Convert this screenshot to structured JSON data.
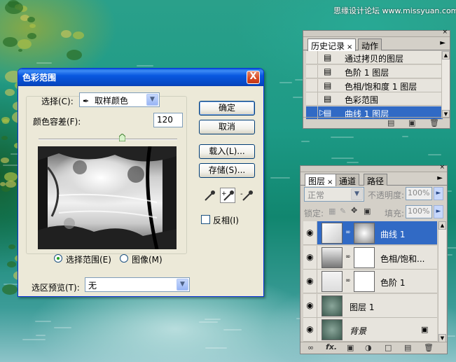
{
  "watermark": "思缘设计论坛 www.missyuan.com",
  "dialog": {
    "title": "色彩范围",
    "close_label": "X",
    "select_label": "选择(C):",
    "select_value": "取样颜色",
    "fuzziness_label": "颜色容差(F):",
    "fuzziness_value": "120",
    "fuzziness_level": 120,
    "fuzziness_max": 200,
    "radio_selection": "选择范围(E)",
    "radio_image": "图像(M)",
    "selected_radio": "selection",
    "preview_label": "选区预览(T):",
    "preview_value": "无",
    "buttons": {
      "ok": "确定",
      "cancel": "取消",
      "load": "载入(L)...",
      "save": "存储(S)..."
    },
    "invert_label": "反相(I)",
    "invert_checked": false
  },
  "history_panel": {
    "tabs": [
      {
        "label": "历史记录",
        "active": true
      },
      {
        "label": "动作",
        "active": false
      }
    ],
    "items": [
      {
        "label": "通过拷贝的图层",
        "selected": false
      },
      {
        "label": "色阶 1 图层",
        "selected": false
      },
      {
        "label": "色相/饱和度 1 图层",
        "selected": false
      },
      {
        "label": "色彩范围",
        "selected": false
      },
      {
        "label": "曲线 1 图层",
        "selected": true
      }
    ]
  },
  "layers_panel": {
    "tabs": [
      {
        "label": "图层",
        "active": true
      },
      {
        "label": "通道",
        "active": false
      },
      {
        "label": "路径",
        "active": false
      }
    ],
    "blend_mode": "正常",
    "opacity_label": "不透明度:",
    "opacity_value": "100%",
    "lock_label": "锁定:",
    "fill_label": "填充:",
    "fill_value": "100%",
    "layers": [
      {
        "name": "曲线 1",
        "selected": true
      },
      {
        "name": "色相/饱和...",
        "selected": false
      },
      {
        "name": "色阶 1",
        "selected": false
      },
      {
        "name": "图层 1",
        "selected": false
      },
      {
        "name": "背景",
        "selected": false
      }
    ]
  },
  "colors": {
    "xp_title": "#0a5bd8",
    "selection": "#316ac5",
    "dialog_bg": "#ece9d8"
  }
}
